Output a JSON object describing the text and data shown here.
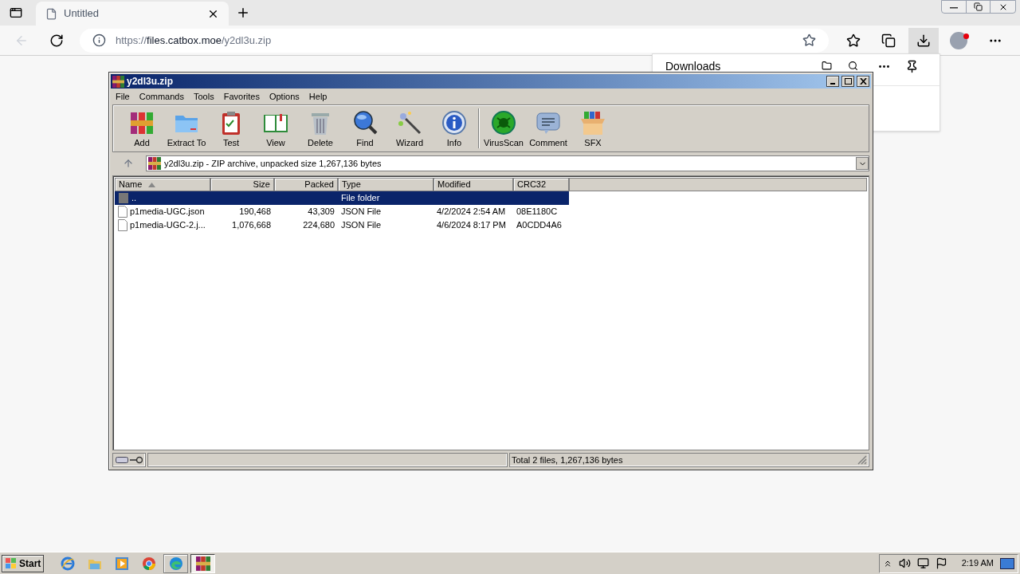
{
  "browser": {
    "tabs": [
      {
        "title": "Untitled",
        "selected": true
      }
    ],
    "url": {
      "scheme": "https://",
      "host": "files.catbox.moe",
      "path": "/y2dl3u.zip"
    }
  },
  "downloads_panel": {
    "title": "Downloads"
  },
  "archiver": {
    "title": "y2dl3u.zip",
    "menu": [
      "File",
      "Commands",
      "Tools",
      "Favorites",
      "Options",
      "Help"
    ],
    "toolbar": [
      {
        "label": "Add",
        "kind": "add",
        "separator_before": false
      },
      {
        "label": "Extract To",
        "kind": "extract",
        "separator_before": false
      },
      {
        "label": "Test",
        "kind": "test",
        "separator_before": false
      },
      {
        "label": "View",
        "kind": "view",
        "separator_before": false
      },
      {
        "label": "Delete",
        "kind": "delete",
        "separator_before": false
      },
      {
        "label": "Find",
        "kind": "find",
        "separator_before": false
      },
      {
        "label": "Wizard",
        "kind": "wizard",
        "separator_before": false
      },
      {
        "label": "Info",
        "kind": "info",
        "separator_before": false
      },
      {
        "label": "VirusScan",
        "kind": "virus",
        "separator_before": true
      },
      {
        "label": "Comment",
        "kind": "comment",
        "separator_before": false
      },
      {
        "label": "SFX",
        "kind": "sfx",
        "separator_before": false
      }
    ],
    "path": "y2dl3u.zip - ZIP archive, unpacked size 1,267,136 bytes",
    "columns": [
      {
        "label": "Name",
        "sorted": true
      },
      {
        "label": "Size",
        "sorted": false
      },
      {
        "label": "Packed",
        "sorted": false
      },
      {
        "label": "Type",
        "sorted": false
      },
      {
        "label": "Modified",
        "sorted": false
      },
      {
        "label": "CRC32",
        "sorted": false
      }
    ],
    "rows": [
      {
        "kind": "folder",
        "selected": true,
        "cells": [
          "..",
          "",
          "",
          "File folder",
          "",
          ""
        ]
      },
      {
        "kind": "file",
        "selected": false,
        "cells": [
          "p1media-UGC.json",
          "190,468",
          "43,309",
          "JSON File",
          "4/2/2024 2:54 AM",
          "08E1180C"
        ]
      },
      {
        "kind": "file",
        "selected": false,
        "cells": [
          "p1media-UGC-2.j...",
          "1,076,668",
          "224,680",
          "JSON File",
          "4/6/2024 8:17 PM",
          "A0CDD4A6"
        ]
      }
    ],
    "status": "Total 2 files, 1,267,136 bytes"
  },
  "taskbar": {
    "start": "Start",
    "apps": [
      {
        "kind": "ie",
        "open": false,
        "selected": false
      },
      {
        "kind": "explorer",
        "open": false,
        "selected": false
      },
      {
        "kind": "media",
        "open": false,
        "selected": false
      },
      {
        "kind": "chrome",
        "open": false,
        "selected": false
      },
      {
        "kind": "edge",
        "open": true,
        "selected": false
      },
      {
        "kind": "winrar",
        "open": true,
        "selected": true
      }
    ],
    "clock": "2:19 AM"
  }
}
